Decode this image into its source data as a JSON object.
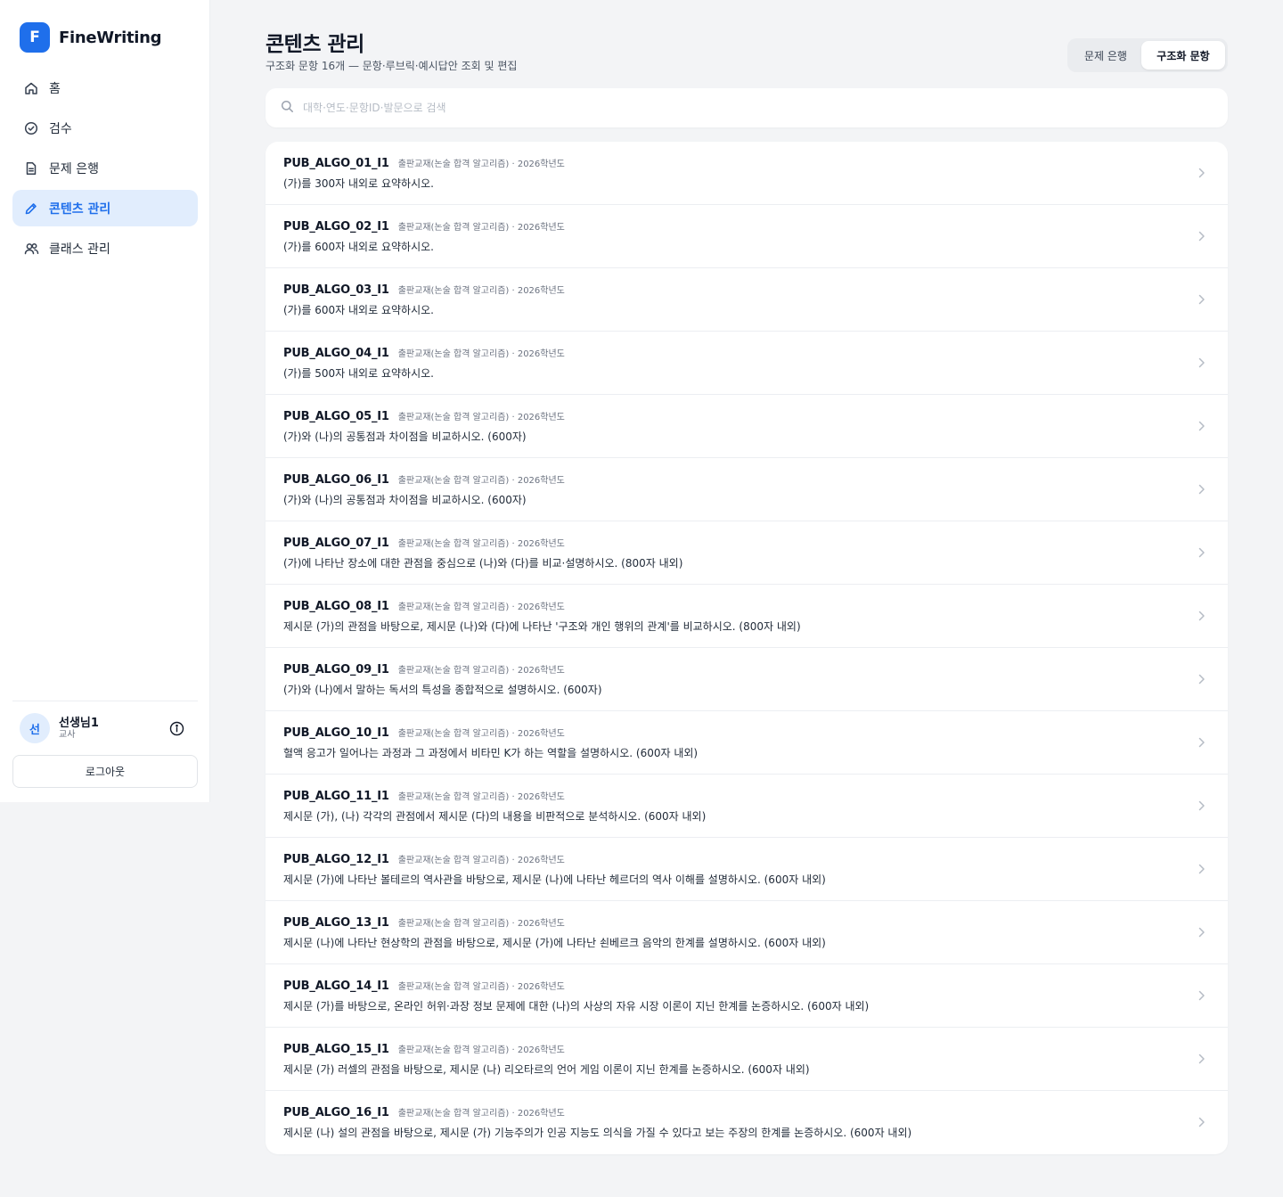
{
  "brand": {
    "logo_letter": "F",
    "name": "FineWriting"
  },
  "nav": [
    {
      "label": "홈",
      "icon": "home-icon",
      "active": false
    },
    {
      "label": "검수",
      "icon": "check-circle-icon",
      "active": false
    },
    {
      "label": "문제 은행",
      "icon": "document-icon",
      "active": false
    },
    {
      "label": "콘텐츠 관리",
      "icon": "pencil-icon",
      "active": true
    },
    {
      "label": "클래스 관리",
      "icon": "users-icon",
      "active": false
    }
  ],
  "user": {
    "avatar_letter": "선",
    "name": "선생님1",
    "role": "교사"
  },
  "logout_label": "로그아웃",
  "header": {
    "title": "콘텐츠 관리",
    "subtitle": "구조화 문항 16개 — 문항·루브릭·예시답안 조회 및 편집"
  },
  "toggle": {
    "option1": "문제 은행",
    "option2": "구조화 문항",
    "selected": "구조화 문항"
  },
  "search": {
    "placeholder": "대학·연도·문항ID·발문으로 검색",
    "value": ""
  },
  "colors": {
    "accent": "#1f6feb",
    "active_bg": "#e1edfd",
    "page_bg": "#f3f4f6"
  },
  "items": [
    {
      "id": "PUB_ALGO_01_I1",
      "meta": "출판교재(논술 합격 알고리즘) · 2026학년도",
      "prompt": "(가)를 300자 내외로 요약하시오."
    },
    {
      "id": "PUB_ALGO_02_I1",
      "meta": "출판교재(논술 합격 알고리즘) · 2026학년도",
      "prompt": "(가)를 600자 내외로 요약하시오."
    },
    {
      "id": "PUB_ALGO_03_I1",
      "meta": "출판교재(논술 합격 알고리즘) · 2026학년도",
      "prompt": "(가)를 600자 내외로 요약하시오."
    },
    {
      "id": "PUB_ALGO_04_I1",
      "meta": "출판교재(논술 합격 알고리즘) · 2026학년도",
      "prompt": "(가)를 500자 내외로 요약하시오."
    },
    {
      "id": "PUB_ALGO_05_I1",
      "meta": "출판교재(논술 합격 알고리즘) · 2026학년도",
      "prompt": "(가)와 (나)의 공통점과 차이점을 비교하시오. (600자)"
    },
    {
      "id": "PUB_ALGO_06_I1",
      "meta": "출판교재(논술 합격 알고리즘) · 2026학년도",
      "prompt": "(가)와 (나)의 공통점과 차이점을 비교하시오. (600자)"
    },
    {
      "id": "PUB_ALGO_07_I1",
      "meta": "출판교재(논술 합격 알고리즘) · 2026학년도",
      "prompt": "(가)에 나타난 장소에 대한 관점을 중심으로 (나)와 (다)를 비교·설명하시오. (800자 내외)"
    },
    {
      "id": "PUB_ALGO_08_I1",
      "meta": "출판교재(논술 합격 알고리즘) · 2026학년도",
      "prompt": "제시문 (가)의 관점을 바탕으로, 제시문 (나)와 (다)에 나타난 '구조와 개인 행위의 관계'를 비교하시오. (800자 내외)"
    },
    {
      "id": "PUB_ALGO_09_I1",
      "meta": "출판교재(논술 합격 알고리즘) · 2026학년도",
      "prompt": "(가)와 (나)에서 말하는 독서의 특성을 종합적으로 설명하시오. (600자)"
    },
    {
      "id": "PUB_ALGO_10_I1",
      "meta": "출판교재(논술 합격 알고리즘) · 2026학년도",
      "prompt": "혈액 응고가 일어나는 과정과 그 과정에서 비타민 K가 하는 역할을 설명하시오. (600자 내외)"
    },
    {
      "id": "PUB_ALGO_11_I1",
      "meta": "출판교재(논술 합격 알고리즘) · 2026학년도",
      "prompt": "제시문 (가), (나) 각각의 관점에서 제시문 (다)의 내용을 비판적으로 분석하시오. (600자 내외)"
    },
    {
      "id": "PUB_ALGO_12_I1",
      "meta": "출판교재(논술 합격 알고리즘) · 2026학년도",
      "prompt": "제시문 (가)에 나타난 볼테르의 역사관을 바탕으로, 제시문 (나)에 나타난 헤르더의 역사 이해를 설명하시오. (600자 내외)"
    },
    {
      "id": "PUB_ALGO_13_I1",
      "meta": "출판교재(논술 합격 알고리즘) · 2026학년도",
      "prompt": "제시문 (나)에 나타난 현상학의 관점을 바탕으로, 제시문 (가)에 나타난 쇤베르크 음악의 한계를 설명하시오. (600자 내외)"
    },
    {
      "id": "PUB_ALGO_14_I1",
      "meta": "출판교재(논술 합격 알고리즘) · 2026학년도",
      "prompt": "제시문 (가)를 바탕으로, 온라인 허위·과장 정보 문제에 대한 (나)의 사상의 자유 시장 이론이 지닌 한계를 논증하시오. (600자 내외)"
    },
    {
      "id": "PUB_ALGO_15_I1",
      "meta": "출판교재(논술 합격 알고리즘) · 2026학년도",
      "prompt": "제시문 (가) 러셀의 관점을 바탕으로, 제시문 (나) 리오타르의 언어 게임 이론이 지닌 한계를 논증하시오. (600자 내외)"
    },
    {
      "id": "PUB_ALGO_16_I1",
      "meta": "출판교재(논술 합격 알고리즘) · 2026학년도",
      "prompt": "제시문 (나) 설의 관점을 바탕으로, 제시문 (가) 기능주의가 인공 지능도 의식을 가질 수 있다고 보는 주장의 한계를 논증하시오. (600자 내외)"
    }
  ]
}
